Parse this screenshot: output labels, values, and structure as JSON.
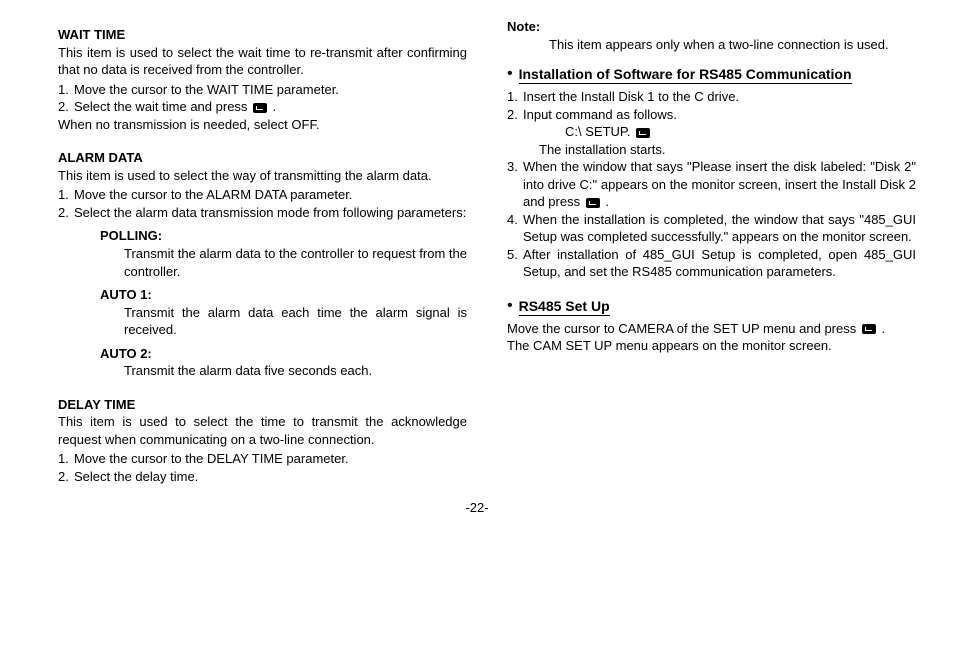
{
  "left": {
    "wait": {
      "title": "WAIT TIME",
      "p1": "This item is used to select the wait time to re-transmit after confirming that no data is received from the controller.",
      "i1": "Move the cursor to the WAIT TIME parameter.",
      "i2a": "Select the wait time and press ",
      "i2b": " .",
      "p2": "When no transmission is needed, select OFF."
    },
    "alarm": {
      "title": "ALARM DATA",
      "p1": "This item is used to select the way of transmitting the alarm data.",
      "i1": "Move the cursor to the ALARM DATA parameter.",
      "i2": "Select the alarm data transmission mode from following parameters:",
      "poll_t": "POLLING:",
      "poll_d": "Transmit the alarm data to the controller to request from the controller.",
      "a1_t": "AUTO 1:",
      "a1_d": "Transmit the alarm data each time the alarm signal is received.",
      "a2_t": "AUTO 2:",
      "a2_d": "Transmit the alarm data five seconds each."
    },
    "delay": {
      "title": "DELAY TIME",
      "p1": "This item is used to select the time to transmit the acknowledge request when communicating on a two-line connection.",
      "i1": "Move the cursor to the DELAY TIME parameter.",
      "i2": "Select the delay time."
    }
  },
  "right": {
    "note": {
      "title": "Note:",
      "p1": "This item appears only when a two-line connection is used."
    },
    "install": {
      "title": "Installation of Software for RS485 Communication",
      "i1": "Insert the Install Disk 1 to the C drive.",
      "i2": "Input command as follows.",
      "cmd": "C:\\ SETUP. ",
      "i2b": "The installation starts.",
      "i3a": "When the window that says \"Please insert the disk labeled: \"Disk 2\" into drive C:\" appears on the monitor screen, insert the Install Disk 2 and press ",
      "i3b": " .",
      "i4": "When the installation is completed, the window that says \"485_GUI Setup was completed successfully.\" appears on the monitor screen.",
      "i5": "After installation of 485_GUI Setup is completed, open 485_GUI Setup, and set the RS485 communication parameters."
    },
    "setup": {
      "title": "RS485 Set Up",
      "p1a": "Move the cursor to CAMERA of the SET UP menu and press ",
      "p1b": " .",
      "p2": "The CAM SET UP menu appears on the monitor screen."
    }
  },
  "pagenum": "-22-"
}
